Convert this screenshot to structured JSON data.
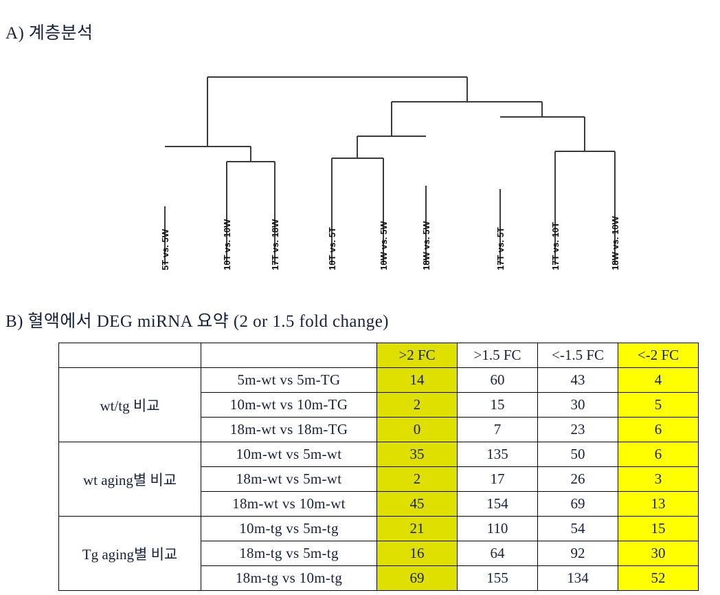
{
  "sections": {
    "a_title": "A) 계층분석",
    "b_title": "B) 혈액에서 DEG miRNA 요약 (2 or 1.5 fold change)"
  },
  "dendrogram": {
    "leaves": [
      "5T vs. 5W",
      "10T vs. 10W",
      "17T vs. 18W",
      "10T vs. 5T",
      "10W vs. 5W",
      "18W vs. 5W",
      "17T vs. 5T",
      "17T vs. 10T",
      "18W vs. 10W"
    ]
  },
  "table": {
    "columns": [
      {
        "label": "",
        "highlight": "none"
      },
      {
        "label": "",
        "highlight": "none"
      },
      {
        "label": ">2 FC",
        "highlight": "olive"
      },
      {
        "label": ">1.5 FC",
        "highlight": "none"
      },
      {
        "label": "<-1.5 FC",
        "highlight": "none"
      },
      {
        "label": "<-2 FC",
        "highlight": "yellow"
      }
    ],
    "groups": [
      {
        "name": "wt/tg 비교",
        "rows": [
          {
            "comparison": "5m-wt vs 5m-TG",
            "gt2": "14",
            "gt15": "60",
            "lt15": "43",
            "lt2": "4"
          },
          {
            "comparison": "10m-wt vs 10m-TG",
            "gt2": "2",
            "gt15": "15",
            "lt15": "30",
            "lt2": "5"
          },
          {
            "comparison": "18m-wt vs 18m-TG",
            "gt2": "0",
            "gt15": "7",
            "lt15": "23",
            "lt2": "6"
          }
        ]
      },
      {
        "name": "wt aging별 비교",
        "rows": [
          {
            "comparison": "10m-wt vs 5m-wt",
            "gt2": "35",
            "gt15": "135",
            "lt15": "50",
            "lt2": "6"
          },
          {
            "comparison": "18m-wt vs 5m-wt",
            "gt2": "2",
            "gt15": "17",
            "lt15": "26",
            "lt2": "3"
          },
          {
            "comparison": "18m-wt vs 10m-wt",
            "gt2": "45",
            "gt15": "154",
            "lt15": "69",
            "lt2": "13"
          }
        ]
      },
      {
        "name": "Tg aging별 비교",
        "rows": [
          {
            "comparison": "10m-tg vs 5m-tg",
            "gt2": "21",
            "gt15": "110",
            "lt15": "54",
            "lt2": "15"
          },
          {
            "comparison": "18m-tg vs 5m-tg",
            "gt2": "16",
            "gt15": "64",
            "lt15": "92",
            "lt2": "30"
          },
          {
            "comparison": "18m-tg vs 10m-tg",
            "gt2": "69",
            "gt15": "155",
            "lt15": "134",
            "lt2": "52"
          }
        ]
      }
    ]
  },
  "colors": {
    "highlight_olive": "#e0e000",
    "highlight_yellow": "#ffff00",
    "line": "#3a3a3a",
    "text": "#16213e"
  }
}
